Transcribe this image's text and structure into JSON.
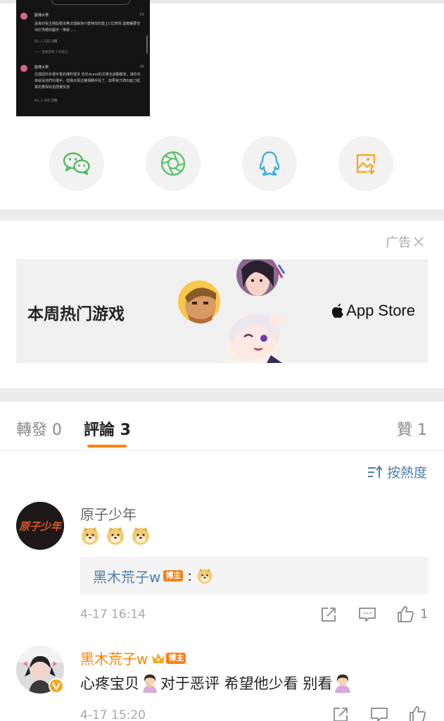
{
  "thumbnail": {
    "comment1": {
      "name": "歐傳大學",
      "likes": "63",
      "text": "說真的看主題貼根本無法理解為什麼特效的當上C位表情 誠實曬要曾出於亮眼的圖手一堆啟......",
      "meta": "B3, 1 天前    回覆",
      "more": "—— 查看其他 2 則留言"
    },
    "comment2": {
      "name": "歐傳大學",
      "likes": "36",
      "text": "這樣因你多選手真的爆料很多 去年dcard的文章全說聊都有，誰你本來就是他們的選手，但我出現這種相關手段了，如果官方適出面力挺真的覺得好過感覺反感",
      "meta": "B4, 1 天前    回覆"
    }
  },
  "share": {
    "icons": [
      "wechat-icon",
      "moments-icon",
      "qq-icon",
      "save-image-icon"
    ]
  },
  "ad": {
    "label": "广告",
    "banner_text": "本周热门游戏",
    "store_text": "App Store"
  },
  "tabs": {
    "repost": "轉發 0",
    "comments": "評論 3",
    "likes": "贊 1"
  },
  "sort": {
    "label": "按熱度"
  },
  "comments": [
    {
      "user": "原子少年",
      "avatar_text": "原子少年",
      "reply_user": "黑木荒子w",
      "reply_badge": "博主",
      "reply_sep": ":",
      "time": "4-17 16:14",
      "like_count": "1"
    },
    {
      "user": "黑木荒子w",
      "badge": "博主",
      "text_a": "心疼宝贝",
      "text_b": "对于恶评 希望他少看 别看",
      "time": "4-17 15:20"
    }
  ],
  "colors": {
    "accent": "#ff8200",
    "link": "#4f7fa8",
    "wechat": "#54b85f",
    "moments": "#5ac06a",
    "qq": "#3fa9e0",
    "save": "#f4a72a"
  }
}
